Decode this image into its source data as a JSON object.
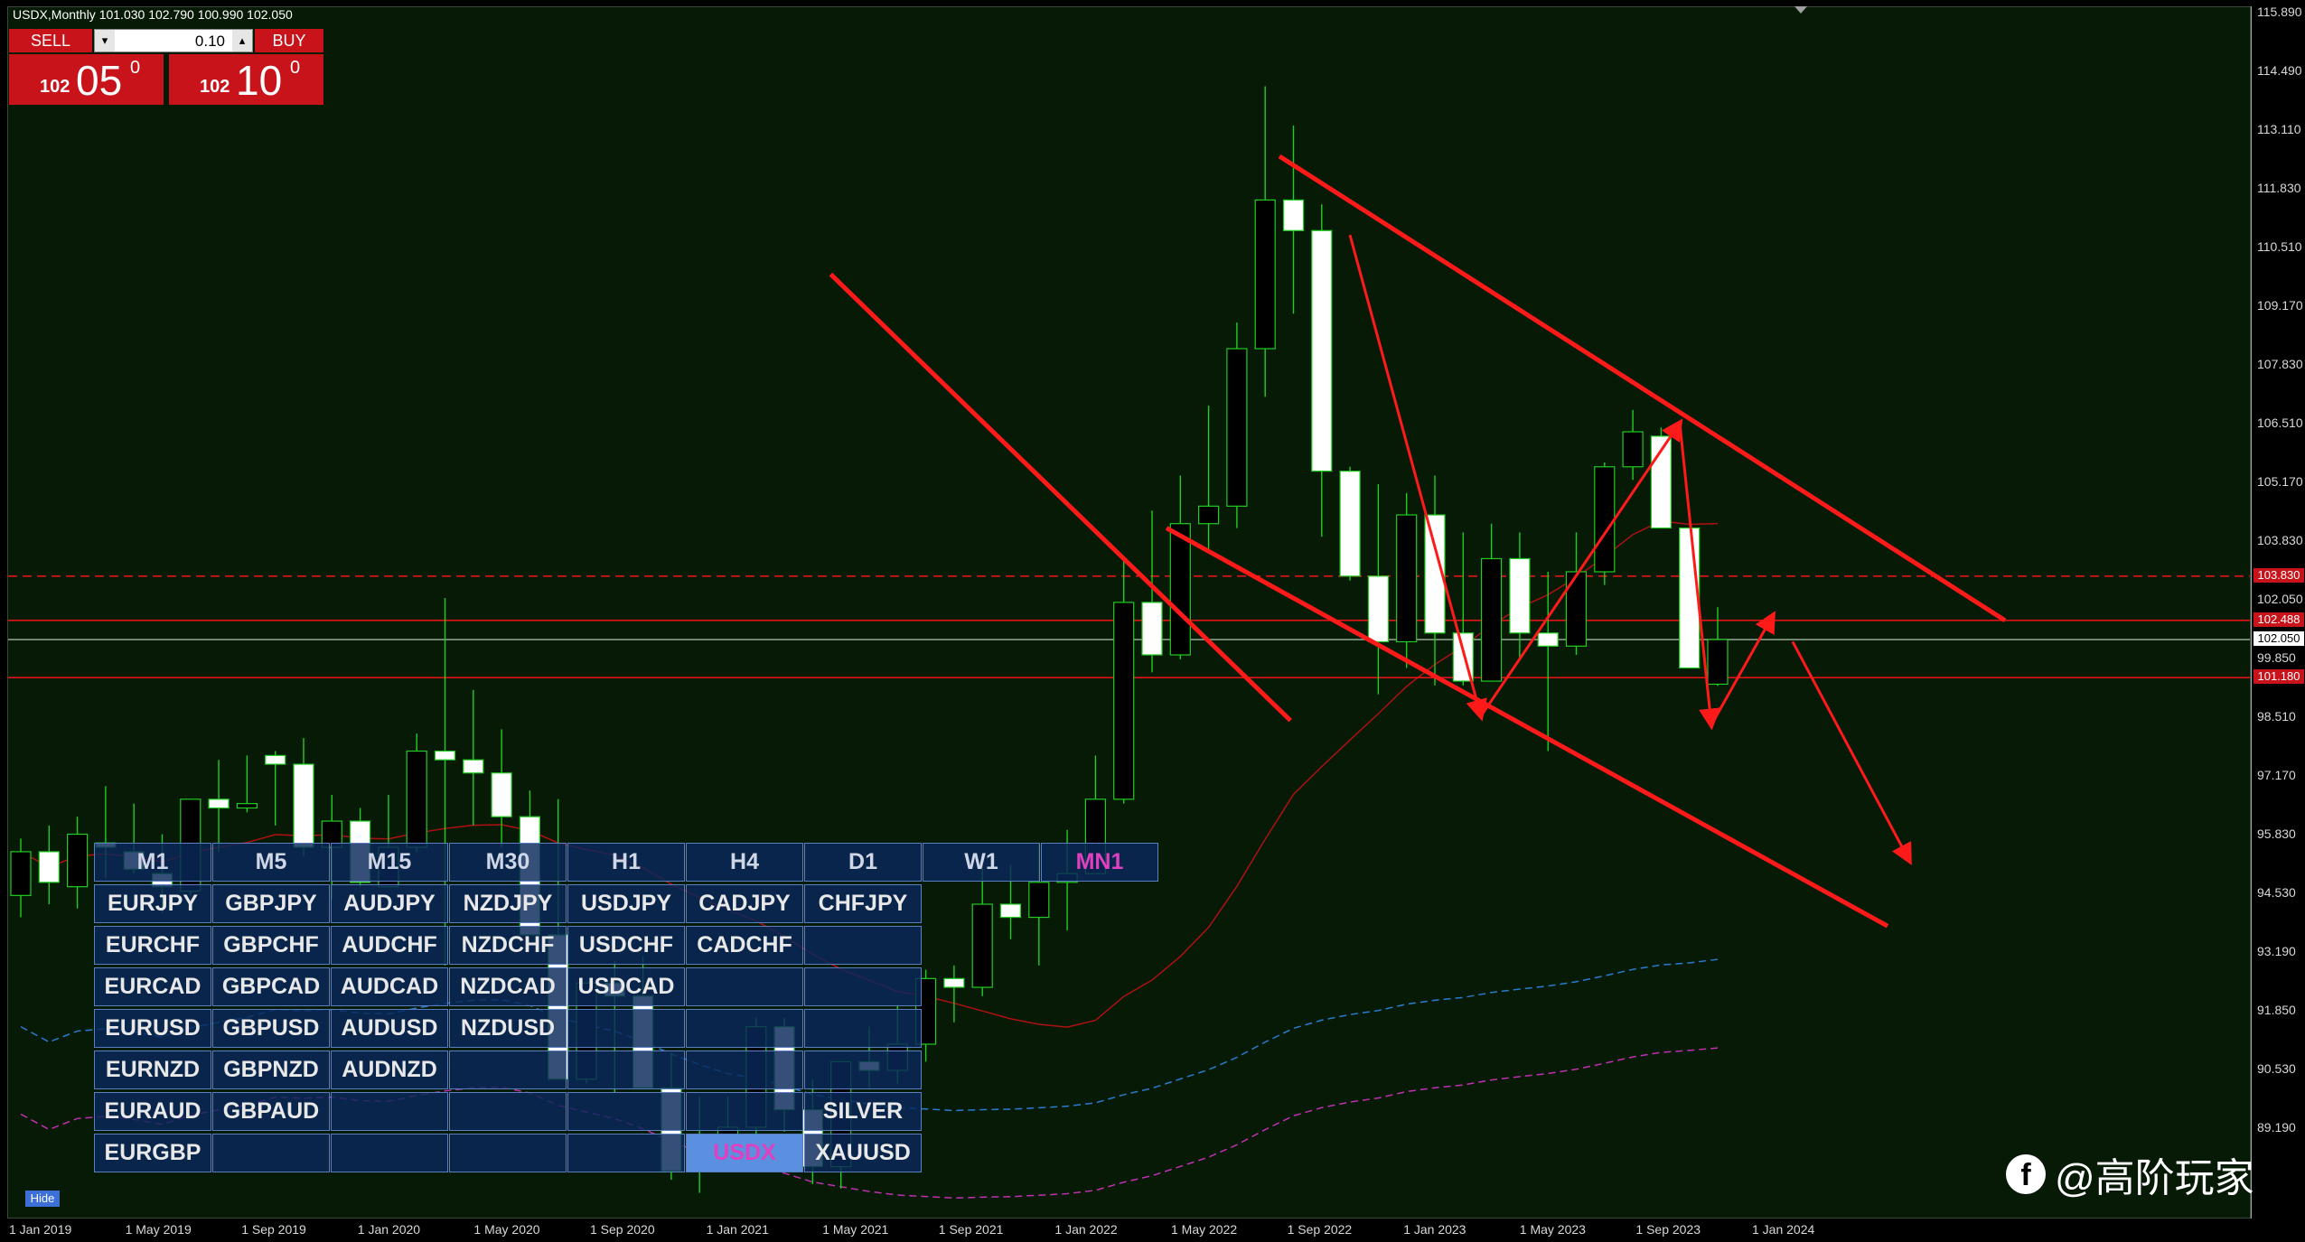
{
  "title": "USDX,Monthly  101.030 102.790 100.990 102.050",
  "trade_panel": {
    "sell_label": "SELL",
    "buy_label": "BUY",
    "lot": "0.10",
    "sell_price_small": "102",
    "sell_price_big": "05",
    "sell_price_sup": "0",
    "buy_price_small": "102",
    "buy_price_big": "10",
    "buy_price_sup": "0"
  },
  "price_axis": {
    "ticks": [
      "115.890",
      "114.490",
      "113.110",
      "111.830",
      "110.510",
      "109.170",
      "107.830",
      "106.510",
      "105.170",
      "103.830",
      "102.050",
      "99.850",
      "98.510",
      "97.170",
      "95.830",
      "94.530",
      "93.190",
      "91.850",
      "90.530",
      "89.190"
    ],
    "tags": [
      {
        "label": "103.830",
        "price": 103.5,
        "bg": "#c8131b",
        "fg": "#ffffff"
      },
      {
        "label": "102.488",
        "price": 102.488,
        "bg": "#c8131b",
        "fg": "#ffffff"
      },
      {
        "label": "102.050",
        "price": 102.05,
        "bg": "#ffffff",
        "fg": "#000000"
      },
      {
        "label": "101.180",
        "price": 101.18,
        "bg": "#c8131b",
        "fg": "#ffffff"
      }
    ]
  },
  "time_axis": {
    "ticks": [
      "1 Jan 2019",
      "1 May 2019",
      "1 Sep 2019",
      "1 Jan 2020",
      "1 May 2020",
      "1 Sep 2020",
      "1 Jan 2021",
      "1 May 2021",
      "1 Sep 2021",
      "1 Jan 2022",
      "1 May 2022",
      "1 Sep 2022",
      "1 Jan 2023",
      "1 May 2023",
      "1 Sep 2023",
      "1 Jan 2024"
    ]
  },
  "switcher": {
    "timeframes": [
      "M1",
      "M5",
      "M15",
      "M30",
      "H1",
      "H4",
      "D1",
      "W1",
      "MN1"
    ],
    "active_timeframe": "MN1",
    "symbols": [
      [
        "EURJPY",
        "GBPJPY",
        "AUDJPY",
        "NZDJPY",
        "USDJPY",
        "CADJPY",
        "CHFJPY"
      ],
      [
        "EURCHF",
        "GBPCHF",
        "AUDCHF",
        "NZDCHF",
        "USDCHF",
        "CADCHF",
        ""
      ],
      [
        "EURCAD",
        "GBPCAD",
        "AUDCAD",
        "NZDCAD",
        "USDCAD",
        "",
        ""
      ],
      [
        "EURUSD",
        "GBPUSD",
        "AUDUSD",
        "NZDUSD",
        "",
        "",
        ""
      ],
      [
        "EURNZD",
        "GBPNZD",
        "AUDNZD",
        "",
        "",
        "",
        ""
      ],
      [
        "EURAUD",
        "GBPAUD",
        "",
        "",
        "",
        "",
        "SILVER"
      ],
      [
        "EURGBP",
        "",
        "",
        "",
        "",
        "USDX",
        "XAUUSD"
      ]
    ],
    "active_symbol": "USDX",
    "hide_label": "Hide"
  },
  "watermark": "@高阶玩家",
  "colors": {
    "background": "#061a06",
    "bull_candle": "#000000",
    "bear_candle": "#ffffff",
    "wick": "#22cc22",
    "annotation": "#ff1a1a"
  },
  "chart_data": {
    "type": "candlestick",
    "symbol": "USDX",
    "timeframe": "Monthly",
    "ohlc_last": {
      "open": 101.03,
      "high": 102.79,
      "low": 100.99,
      "close": 102.05
    },
    "ylim": [
      89.0,
      116.3
    ],
    "candles": [
      [
        96.2,
        97.5,
        95.7,
        97.2
      ],
      [
        97.2,
        97.8,
        96.0,
        96.5
      ],
      [
        96.4,
        98.0,
        95.9,
        97.6
      ],
      [
        97.4,
        98.7,
        96.6,
        97.3
      ],
      [
        97.2,
        98.3,
        96.7,
        96.8
      ],
      [
        96.7,
        97.6,
        95.8,
        96.4
      ],
      [
        96.3,
        98.4,
        96.2,
        98.4
      ],
      [
        98.4,
        99.3,
        97.2,
        98.2
      ],
      [
        98.2,
        99.4,
        98.1,
        98.3
      ],
      [
        99.4,
        99.5,
        97.8,
        99.2
      ],
      [
        99.2,
        99.8,
        97.1,
        97.3
      ],
      [
        97.3,
        98.5,
        96.1,
        97.9
      ],
      [
        97.9,
        98.2,
        96.4,
        96.5
      ],
      [
        96.4,
        98.5,
        96.4,
        97.3
      ],
      [
        97.3,
        99.9,
        97.2,
        99.5
      ],
      [
        99.5,
        103.0,
        94.6,
        99.3
      ],
      [
        99.3,
        100.9,
        97.8,
        99.0
      ],
      [
        99.0,
        100.0,
        97.3,
        98.0
      ],
      [
        98.0,
        98.6,
        95.7,
        95.3
      ],
      [
        95.3,
        98.4,
        92.5,
        92.0
      ],
      [
        92.0,
        94.0,
        91.9,
        94.2
      ],
      [
        94.2,
        94.7,
        91.7,
        93.9
      ],
      [
        93.9,
        94.8,
        92.1,
        91.8
      ],
      [
        91.8,
        92.6,
        89.7,
        89.9
      ],
      [
        89.9,
        91.6,
        89.4,
        90.6
      ],
      [
        90.6,
        91.6,
        90.1,
        90.9
      ],
      [
        90.9,
        93.4,
        90.6,
        93.2
      ],
      [
        93.2,
        93.4,
        90.8,
        91.3
      ],
      [
        91.3,
        92.0,
        89.6,
        90.0
      ],
      [
        90.0,
        92.4,
        89.5,
        92.4
      ],
      [
        92.4,
        93.2,
        91.8,
        92.2
      ],
      [
        92.2,
        93.7,
        91.9,
        92.8
      ],
      [
        92.8,
        94.5,
        92.4,
        94.3
      ],
      [
        94.3,
        94.6,
        93.3,
        94.1
      ],
      [
        94.1,
        96.9,
        93.9,
        96.0
      ],
      [
        96.0,
        96.9,
        95.2,
        95.7
      ],
      [
        95.7,
        97.4,
        94.6,
        96.5
      ],
      [
        96.5,
        97.7,
        95.4,
        96.7
      ],
      [
        96.7,
        99.4,
        97.6,
        98.4
      ],
      [
        98.4,
        103.9,
        98.3,
        102.9
      ],
      [
        102.9,
        105.0,
        101.3,
        101.7
      ],
      [
        101.7,
        105.8,
        101.6,
        104.7
      ],
      [
        104.7,
        107.4,
        104.1,
        105.1
      ],
      [
        105.1,
        109.3,
        104.6,
        108.7
      ],
      [
        108.7,
        114.7,
        107.6,
        112.1
      ],
      [
        112.1,
        113.8,
        109.5,
        111.4
      ],
      [
        111.4,
        112.0,
        104.4,
        105.9
      ],
      [
        105.9,
        106.0,
        103.4,
        103.5
      ],
      [
        103.5,
        105.6,
        100.8,
        102.0
      ],
      [
        102.0,
        105.4,
        101.4,
        104.9
      ],
      [
        104.9,
        105.8,
        101.0,
        102.2
      ],
      [
        102.2,
        104.5,
        101.0,
        101.1
      ],
      [
        101.1,
        104.7,
        101.2,
        103.9
      ],
      [
        103.9,
        104.5,
        101.6,
        102.2
      ],
      [
        102.2,
        103.6,
        99.5,
        101.9
      ],
      [
        101.9,
        104.5,
        101.7,
        103.6
      ],
      [
        103.6,
        106.1,
        103.3,
        106.0
      ],
      [
        106.0,
        107.3,
        105.7,
        106.8
      ],
      [
        106.7,
        106.9,
        104.7,
        104.6
      ],
      [
        104.6,
        104.2,
        101.8,
        101.4
      ],
      [
        101.03,
        102.79,
        100.99,
        102.05
      ]
    ],
    "horizontal_levels": [
      103.5,
      102.488,
      102.05,
      101.18
    ]
  }
}
